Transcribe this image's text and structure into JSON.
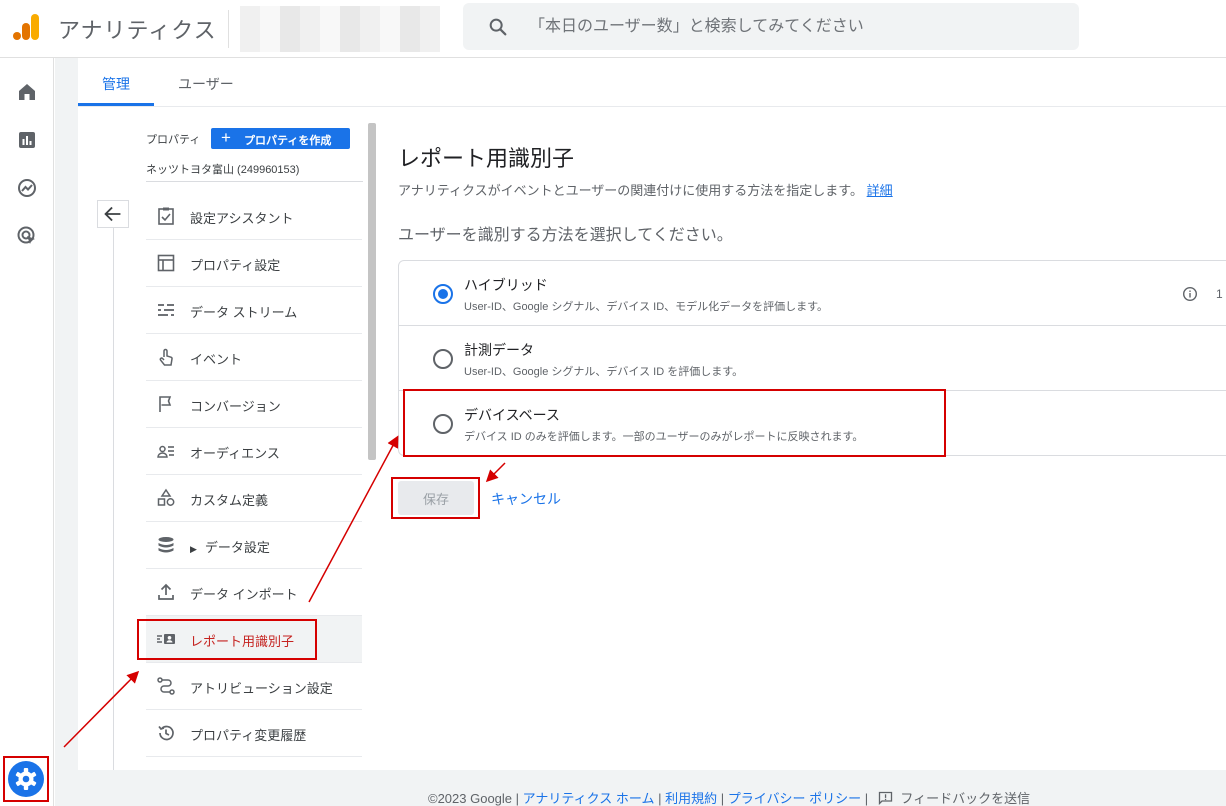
{
  "header": {
    "app_title": "アナリティクス",
    "search_placeholder": "「本日のユーザー数」と検索してみてください"
  },
  "tabs": [
    {
      "label": "管理",
      "active": true
    },
    {
      "label": "ユーザー",
      "active": false
    }
  ],
  "property": {
    "label": "プロパティ",
    "create_button": "プロパティを作成",
    "name": "ネッツトヨタ富山 (249960153)"
  },
  "menu": {
    "items": [
      {
        "label": "設定アシスタント",
        "icon": "checklist-icon"
      },
      {
        "label": "プロパティ設定",
        "icon": "layout-icon"
      },
      {
        "label": "データ ストリーム",
        "icon": "streams-icon"
      },
      {
        "label": "イベント",
        "icon": "touch-icon"
      },
      {
        "label": "コンバージョン",
        "icon": "flag-icon"
      },
      {
        "label": "オーディエンス",
        "icon": "audience-icon"
      },
      {
        "label": "カスタム定義",
        "icon": "shapes-icon"
      },
      {
        "label": "データ設定",
        "icon": "database-icon",
        "expandable": true
      },
      {
        "label": "データ インポート",
        "icon": "upload-icon"
      },
      {
        "label": "レポート用識別子",
        "icon": "identity-icon",
        "active": true
      },
      {
        "label": "アトリビューション設定",
        "icon": "attribution-icon"
      },
      {
        "label": "プロパティ変更履歴",
        "icon": "history-icon"
      }
    ]
  },
  "panel": {
    "title": "レポート用識別子",
    "description": "アナリティクスがイベントとユーザーの関連付けに使用する方法を指定します。",
    "description_link": "詳細",
    "question": "ユーザーを識別する方法を選択してください。",
    "options": [
      {
        "title": "ハイブリッド",
        "subtitle": "User-ID、Google シグナル、デバイス ID、モデル化データを評価します。",
        "selected": true
      },
      {
        "title": "計測データ",
        "subtitle": "User-ID、Google シグナル、デバイス ID を評価します。",
        "selected": false
      },
      {
        "title": "デバイスベース",
        "subtitle": "デバイス ID のみを評価します。一部のユーザーのみがレポートに反映されます。",
        "selected": false
      }
    ],
    "info_number": "1",
    "save_label": "保存",
    "cancel_label": "キャンセル"
  },
  "footer": {
    "copyright": "©2023 Google",
    "separator": "|",
    "links": [
      "アナリティクス ホーム",
      "利用規約",
      "プライバシー ポリシー"
    ],
    "feedback": "フィードバックを送信"
  },
  "colors": {
    "accent": "#1a73e8",
    "annotation": "#d50000",
    "active_text": "#c5221f"
  }
}
